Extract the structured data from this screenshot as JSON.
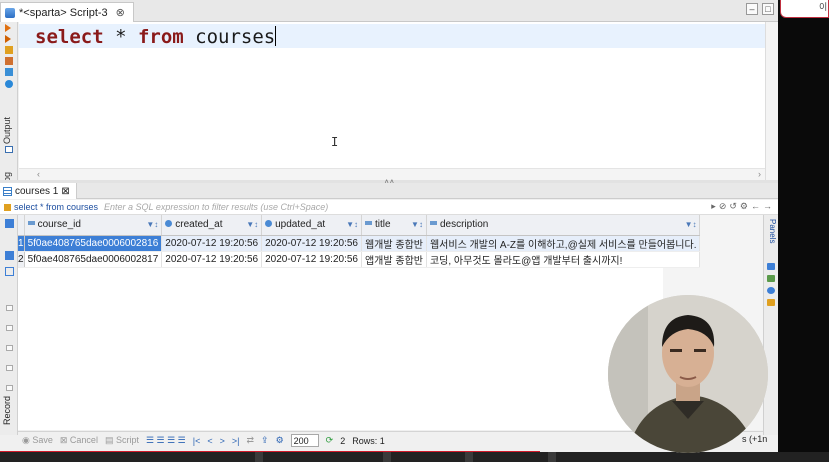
{
  "editor_tab": {
    "title": "*<sparta> Script-3",
    "close": "⊗"
  },
  "left_toolbar": {
    "output_label": "Output",
    "log_label": "Log"
  },
  "editor": {
    "line_kw1": "select",
    "line_mid": " * ",
    "line_kw2": "from",
    "line_tail": " courses"
  },
  "results_tab": {
    "title": "courses 1",
    "close": "⊠"
  },
  "filter": {
    "query": "select * from courses",
    "placeholder": "Enter a SQL expression to filter results (use Ctrl+Space)"
  },
  "grid": {
    "columns": [
      "course_id",
      "created_at",
      "updated_at",
      "title",
      "description"
    ],
    "rows": [
      {
        "n": "1",
        "course_id": "5f0ae408765dae0006002816",
        "created_at": "2020-07-12 19:20:56",
        "updated_at": "2020-07-12 19:20:56",
        "title": "웹개발 종합반",
        "description": "웹서비스 개발의 A-Z를 이해하고,@실제 서비스를 만들어봅니다."
      },
      {
        "n": "2",
        "course_id": "5f0ae408765dae0006002817",
        "created_at": "2020-07-12 19:20:56",
        "updated_at": "2020-07-12 19:20:56",
        "title": "앱개발 종합반",
        "description": "코딩, 아무것도 몰라도@앱 개발부터 출시까지!"
      }
    ]
  },
  "side": {
    "record_label": "Record",
    "panels_label": "Panels"
  },
  "statusbar": {
    "save": "Save",
    "cancel": "Cancel",
    "script": "Script",
    "page_size": "200",
    "fetched": "2",
    "rows": "Rows: 1",
    "right_partial": "s (+1n"
  },
  "colors": {
    "accent": "#3d7fd6",
    "keyword": "#8a1a1a",
    "filter_text": "#1d4ea0"
  }
}
